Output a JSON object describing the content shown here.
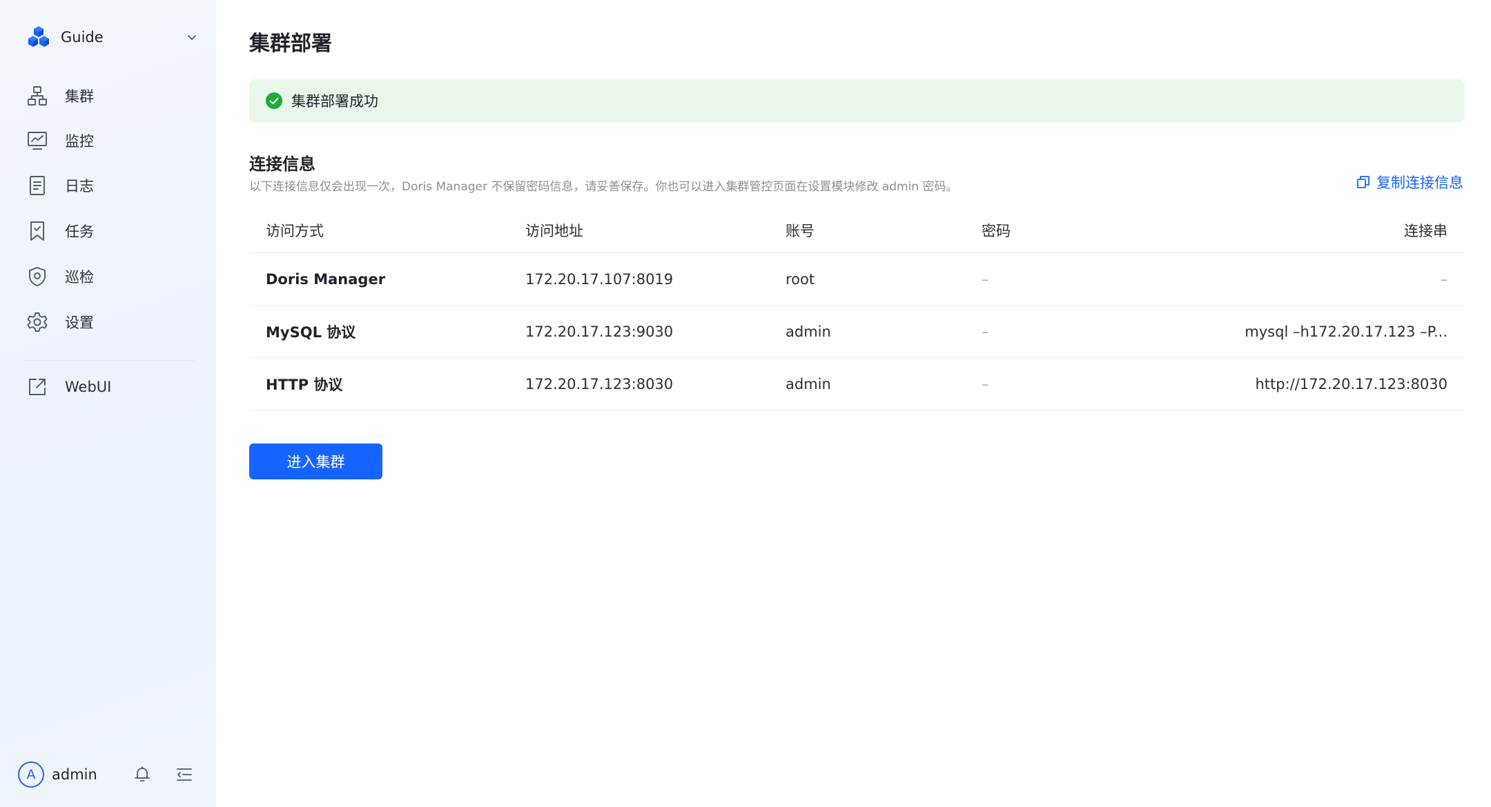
{
  "app": {
    "name": "Guide"
  },
  "sidebar": {
    "items": [
      {
        "label": "集群",
        "icon": "cluster-icon"
      },
      {
        "label": "监控",
        "icon": "monitor-chart-icon"
      },
      {
        "label": "日志",
        "icon": "document-icon"
      },
      {
        "label": "任务",
        "icon": "task-bookmark-icon"
      },
      {
        "label": "巡检",
        "icon": "shield-icon"
      },
      {
        "label": "设置",
        "icon": "gear-icon"
      }
    ],
    "external": {
      "label": "WebUI",
      "icon": "external-link-icon"
    }
  },
  "user": {
    "avatar_letter": "A",
    "name": "admin"
  },
  "page": {
    "title": "集群部署",
    "alert": "集群部署成功",
    "section_title": "连接信息",
    "section_desc": "以下连接信息仅会出现一次，Doris Manager 不保留密码信息，请妥善保存。你也可以进入集群管控页面在设置模块修改 admin 密码。",
    "copy_label": "复制连接信息",
    "enter_button": "进入集群"
  },
  "table": {
    "headers": [
      "访问方式",
      "访问地址",
      "账号",
      "密码",
      "连接串"
    ],
    "rows": [
      {
        "method": "Doris Manager",
        "address": "172.20.17.107:8019",
        "account": "root",
        "password": "–",
        "conn": "–"
      },
      {
        "method": "MySQL 协议",
        "address": "172.20.17.123:9030",
        "account": "admin",
        "password": "–",
        "conn": "mysql –h172.20.17.123 –P..."
      },
      {
        "method": "HTTP 协议",
        "address": "172.20.17.123:8030",
        "account": "admin",
        "password": "–",
        "conn": "http://172.20.17.123:8030"
      }
    ]
  },
  "colors": {
    "primary": "#1664ff",
    "success": "#1aad3c",
    "success_bg": "#e8f7ea",
    "muted": "#8a9099"
  }
}
